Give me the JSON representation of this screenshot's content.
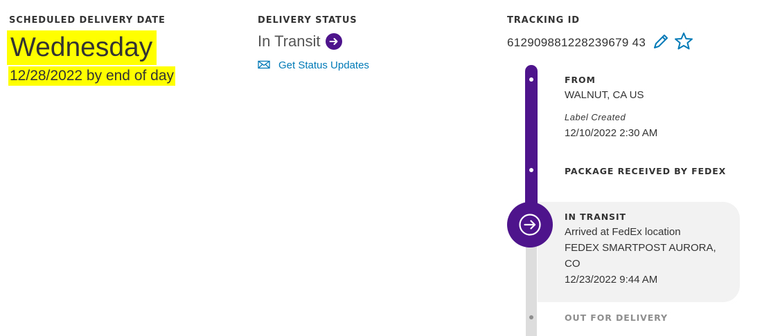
{
  "scheduled": {
    "label": "SCHEDULED DELIVERY DATE",
    "day": "Wednesday",
    "date_line": "12/28/2022 by end of day"
  },
  "status": {
    "label": "DELIVERY STATUS",
    "value": "In Transit",
    "icon": "arrow-right-circle-icon",
    "updates_link": "Get Status Updates",
    "updates_icon": "envelope-icon"
  },
  "tracking": {
    "label": "TRACKING ID",
    "number": "612909881228239679 43",
    "edit_icon": "pencil-icon",
    "favorite_icon": "star-icon"
  },
  "timeline": {
    "from": {
      "label": "FROM",
      "location": "WALNUT, CA US",
      "event": "Label Created",
      "timestamp": "12/10/2022 2:30 AM"
    },
    "received": {
      "label": "PACKAGE RECEIVED BY FEDEX"
    },
    "in_transit": {
      "label": "IN TRANSIT",
      "line1": "Arrived at FedEx location",
      "line2": "FEDEX SMARTPOST AURORA,",
      "line3": "CO",
      "timestamp": "12/23/2022 9:44 AM",
      "icon": "arrow-right-circle-icon"
    },
    "out_for_delivery": {
      "label": "OUT FOR DELIVERY"
    }
  },
  "colors": {
    "brand_purple": "#4d148c",
    "link_blue": "#007ab7",
    "highlight": "#ffff00",
    "muted_gray": "#8e8e8e"
  }
}
